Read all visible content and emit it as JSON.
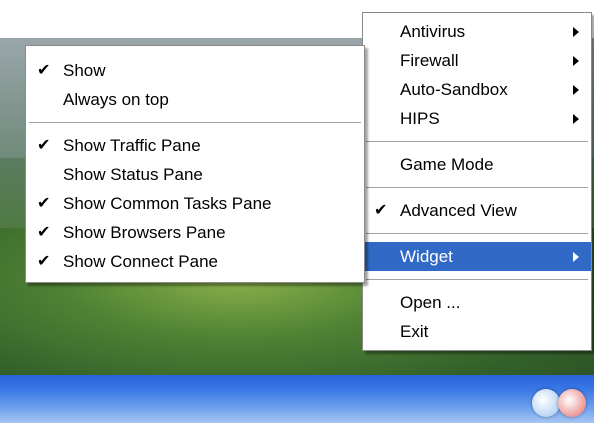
{
  "main_menu": {
    "items": [
      {
        "label": "Antivirus",
        "submenu": true
      },
      {
        "label": "Firewall",
        "submenu": true
      },
      {
        "label": "Auto-Sandbox",
        "submenu": true
      },
      {
        "label": "HIPS",
        "submenu": true
      },
      {
        "label": "Game Mode"
      },
      {
        "label": "Advanced View",
        "checked": true
      },
      {
        "label": "Widget",
        "submenu": true,
        "selected": true
      },
      {
        "label": "Open ..."
      },
      {
        "label": "Exit"
      }
    ],
    "check_glyph": "✔",
    "highlight_color": "#3169c6"
  },
  "widget_menu": {
    "items": [
      {
        "label": "Show",
        "checked": true
      },
      {
        "label": "Always on top",
        "checked": false
      },
      {
        "label": "Show Traffic Pane",
        "checked": true
      },
      {
        "label": "Show Status Pane",
        "checked": false
      },
      {
        "label": "Show Common Tasks Pane",
        "checked": true
      },
      {
        "label": "Show Browsers Pane",
        "checked": true
      },
      {
        "label": "Show Connect Pane",
        "checked": true
      }
    ]
  }
}
